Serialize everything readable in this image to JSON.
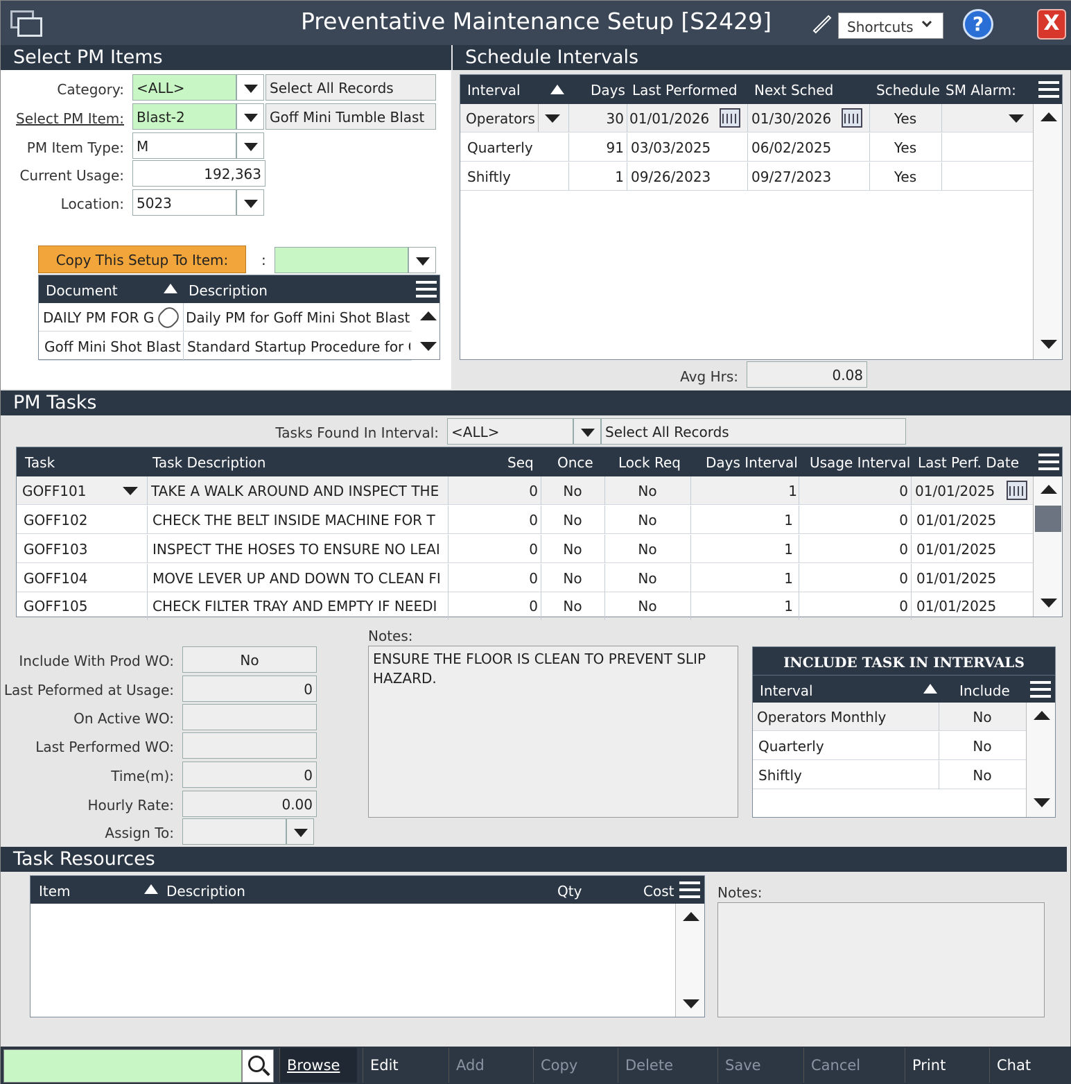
{
  "window": {
    "title": "Preventative Maintenance Setup [S2429]",
    "shortcuts_label": "Shortcuts",
    "help_label": "?",
    "close_label": "X"
  },
  "select_pm": {
    "header": "Select PM Items",
    "category_label": "Category:",
    "category_value": "<ALL>",
    "select_all_label": "Select All Records",
    "pm_item_label": "Select PM Item:",
    "pm_item_value": "Blast-2",
    "pm_item_desc": "Goff Mini Tumble Blast",
    "type_label": "PM Item Type:",
    "type_value": "M",
    "usage_label": "Current Usage:",
    "usage_value": "192,363",
    "location_label": "Location:",
    "location_value": "5023",
    "copy_label": "Copy This Setup To Item:",
    "copy_colon": ":"
  },
  "documents": {
    "col_document": "Document",
    "col_description": "Description",
    "rows": [
      {
        "doc": "DAILY PM FOR GOFF",
        "desc": "Daily PM for Goff Mini Shot Blast"
      },
      {
        "doc": "Goff Mini Shot Blast",
        "desc": "Standard Startup Procedure for Goff"
      }
    ]
  },
  "schedule": {
    "header": "Schedule Intervals",
    "cols": {
      "interval": "Interval",
      "days": "Days",
      "last": "Last Performed",
      "next": "Next Sched",
      "schedule": "Schedule",
      "alarm": "SM Alarm:"
    },
    "rows": [
      {
        "interval": "Operators",
        "days": "30",
        "last": "01/01/2026",
        "next": "01/30/2026",
        "schedule": "Yes",
        "alarm": ""
      },
      {
        "interval": "Quarterly",
        "days": "91",
        "last": "03/03/2025",
        "next": "06/02/2025",
        "schedule": "Yes",
        "alarm": ""
      },
      {
        "interval": "Shiftly",
        "days": "1",
        "last": "09/26/2023",
        "next": "09/27/2023",
        "schedule": "Yes",
        "alarm": ""
      }
    ],
    "avg_label": "Avg Hrs:",
    "avg_value": "0.08"
  },
  "pm_tasks": {
    "header": "PM Tasks",
    "interval_label": "Tasks Found In Interval:",
    "interval_value": "<ALL>",
    "select_all_label": "Select All Records",
    "cols": {
      "task": "Task",
      "desc": "Task Description",
      "seq": "Seq",
      "once": "Once",
      "lock": "Lock Req",
      "days": "Days Interval",
      "usage": "Usage Interval",
      "last": "Last Perf. Date"
    },
    "rows": [
      {
        "task": "GOFF101",
        "desc": "TAKE A WALK AROUND AND INSPECT THE",
        "seq": "0",
        "once": "No",
        "lock": "No",
        "days": "1",
        "usage": "0",
        "last": "01/01/2025"
      },
      {
        "task": "GOFF102",
        "desc": "CHECK THE BELT INSIDE MACHINE FOR T",
        "seq": "0",
        "once": "No",
        "lock": "No",
        "days": "1",
        "usage": "0",
        "last": "01/01/2025"
      },
      {
        "task": "GOFF103",
        "desc": "INSPECT THE HOSES TO ENSURE NO LEAI",
        "seq": "0",
        "once": "No",
        "lock": "No",
        "days": "1",
        "usage": "0",
        "last": "01/01/2025"
      },
      {
        "task": "GOFF104",
        "desc": "MOVE LEVER UP AND DOWN TO CLEAN FI",
        "seq": "0",
        "once": "No",
        "lock": "No",
        "days": "1",
        "usage": "0",
        "last": "01/01/2025"
      },
      {
        "task": "GOFF105",
        "desc": "CHECK FILTER TRAY AND EMPTY IF NEEDI",
        "seq": "0",
        "once": "No",
        "lock": "No",
        "days": "1",
        "usage": "0",
        "last": "01/01/2025"
      }
    ]
  },
  "task_detail": {
    "include_prod_label": "Include With Prod WO:",
    "include_prod_value": "No",
    "last_usage_label": "Last Peformed at Usage:",
    "last_usage_value": "0",
    "active_wo_label": "On Active WO:",
    "active_wo_value": "",
    "last_wo_label": "Last Performed WO:",
    "last_wo_value": "",
    "time_label": "Time(m):",
    "time_value": "0",
    "rate_label": "Hourly Rate:",
    "rate_value": "0.00",
    "assign_label": "Assign To:",
    "assign_value": "",
    "notes_label": "Notes:",
    "notes_value": "ENSURE THE FLOOR IS CLEAN TO PREVENT SLIP HAZARD."
  },
  "include_intervals": {
    "title": "INCLUDE TASK IN INTERVALS",
    "col_interval": "Interval",
    "col_include": "Include",
    "rows": [
      {
        "interval": "Operators Monthly",
        "include": "No"
      },
      {
        "interval": "Quarterly",
        "include": "No"
      },
      {
        "interval": "Shiftly",
        "include": "No"
      }
    ]
  },
  "resources": {
    "header": "Task Resources",
    "cols": {
      "item": "Item",
      "desc": "Description",
      "qty": "Qty",
      "cost": "Cost"
    },
    "notes_label": "Notes:"
  },
  "toolbar": {
    "browse": "Browse",
    "edit": "Edit",
    "add": "Add",
    "copy": "Copy",
    "delete": "Delete",
    "save": "Save",
    "cancel": "Cancel",
    "print": "Print",
    "chat": "Chat"
  },
  "colors": {
    "header_bg": "#2c3746",
    "green_field": "#c8f7c5",
    "copy_button": "#f2a53a"
  }
}
